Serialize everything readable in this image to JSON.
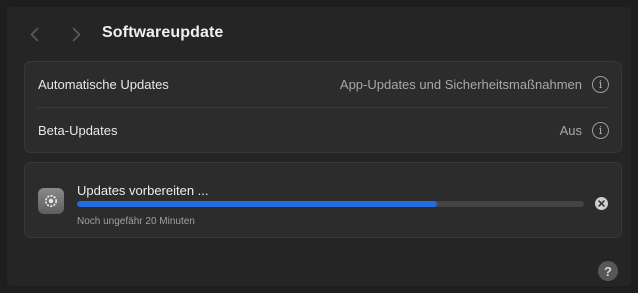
{
  "window": {
    "title": "Softwareupdate"
  },
  "settings": {
    "rows": [
      {
        "label": "Automatische Updates",
        "value": "App-Updates und Sicherheitsmaßnahmen",
        "info_icon": "info-circle-icon"
      },
      {
        "label": "Beta-Updates",
        "value": "Aus",
        "info_icon": "info-circle-icon"
      }
    ]
  },
  "update": {
    "title": "Updates vorbereiten ...",
    "subtitle": "Noch ungefähr 20 Minuten",
    "progress": 0.71,
    "icon": "software-update-gear-icon",
    "progress_color": "#1f6de0"
  },
  "help": {
    "label": "?"
  },
  "icons": {
    "back": "chevron-left-icon",
    "forward": "chevron-right-icon",
    "cancel": "close-circle-icon"
  }
}
